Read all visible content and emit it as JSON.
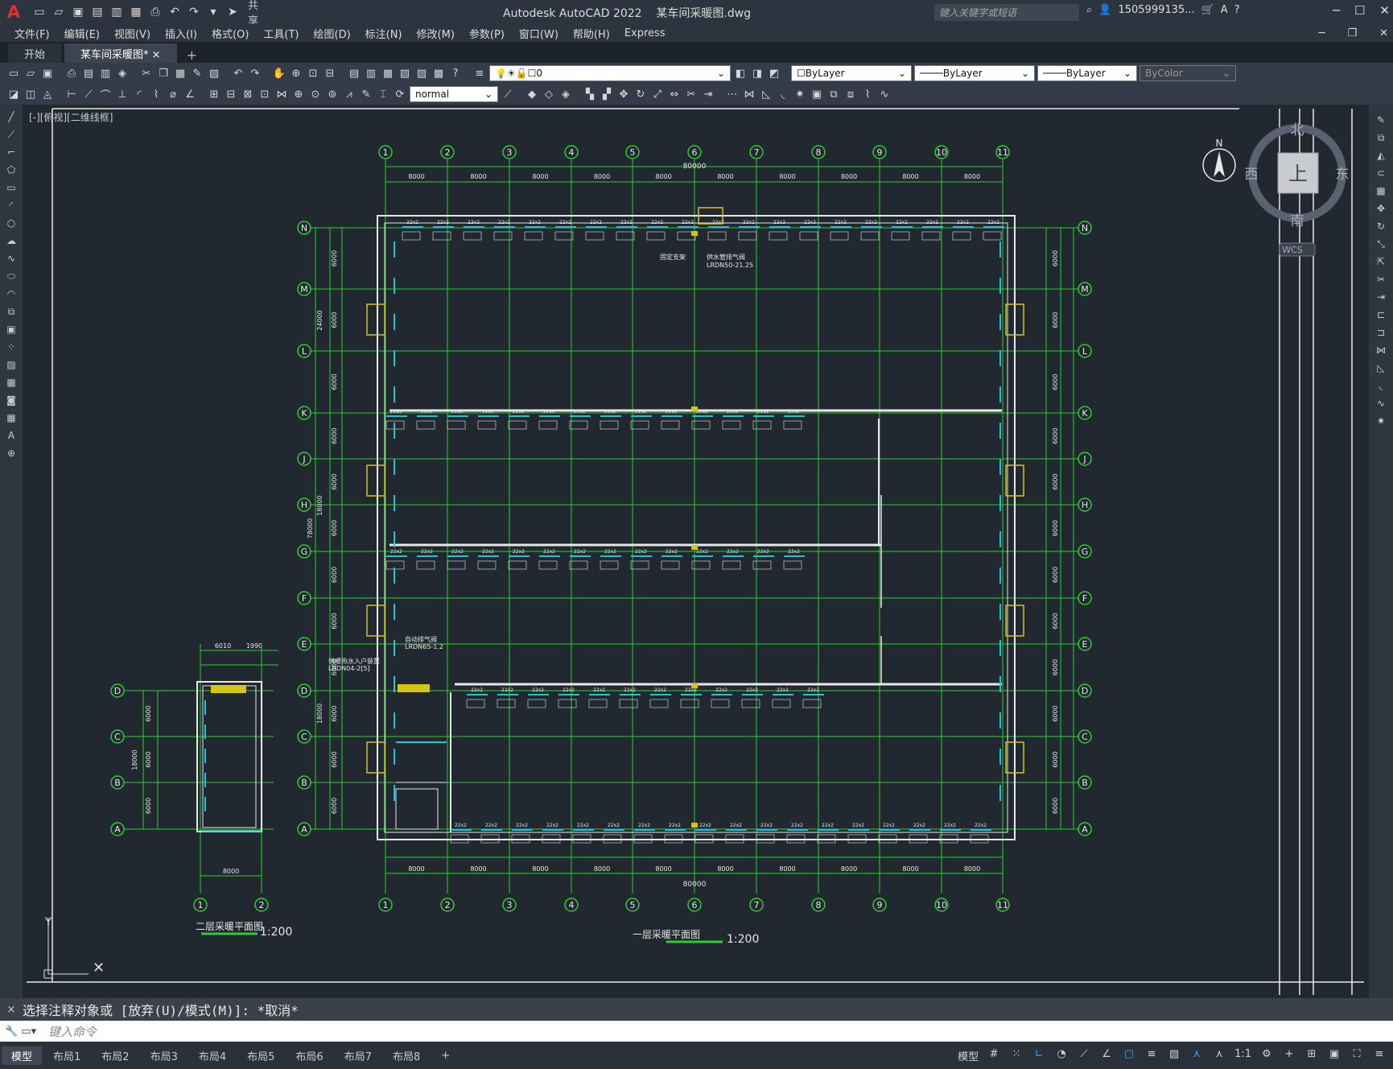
{
  "app": {
    "title": "Autodesk AutoCAD 2022",
    "file": "某车间采暖图.dwg",
    "share": "共享",
    "search_placeholder": "键入关键字或短语",
    "user": "1505999135...",
    "logo": "A"
  },
  "menu": [
    "文件(F)",
    "编辑(E)",
    "视图(V)",
    "插入(I)",
    "格式(O)",
    "工具(T)",
    "绘图(D)",
    "标注(N)",
    "修改(M)",
    "参数(P)",
    "窗口(W)",
    "帮助(H)",
    "Express"
  ],
  "tabs": {
    "start": "开始",
    "doc": "某车间采暖图*",
    "close": "×",
    "plus": "+"
  },
  "toolbar": {
    "layer": "0",
    "color": "ByLayer",
    "linetype": "ByLayer",
    "lineweight": "ByLayer",
    "plotstyle": "ByColor",
    "textstyle": "normal"
  },
  "viewport": {
    "label": "[-][俯视][二维线框]"
  },
  "viewcube": {
    "north": "北",
    "south": "南",
    "east": "东",
    "west": "西",
    "top": "上",
    "wcs": "WCS",
    "compass": "N"
  },
  "drawing": {
    "grid_cols": [
      "1",
      "2",
      "3",
      "4",
      "5",
      "6",
      "7",
      "8",
      "9",
      "10",
      "11"
    ],
    "grid_rows": [
      "N",
      "M",
      "L",
      "K",
      "J",
      "H",
      "G",
      "F",
      "E",
      "D",
      "C",
      "B",
      "A"
    ],
    "span": "8000",
    "total_width": "80000",
    "left_dims": [
      "6000",
      "6000",
      "6000",
      "6000",
      "6000",
      "6000",
      "6000",
      "6000",
      "6000",
      "6000",
      "6000",
      "6000"
    ],
    "left_totals": [
      "24000",
      "18000",
      "78000",
      "18000",
      "18000"
    ],
    "title1": "一层采暖平面图",
    "scale1": "1:200",
    "title2": "二层采暖平面图",
    "scale2": "1:200",
    "small_cols": [
      "1",
      "2"
    ],
    "small_rows": [
      "D",
      "C",
      "B",
      "A"
    ],
    "small_dims": [
      "6010",
      "1990"
    ],
    "small_bottom": "8000",
    "small_left": [
      "6000",
      "6000",
      "6000"
    ],
    "small_total": "18000",
    "ann1": "固定支架",
    "ann2": "供水管排气阀",
    "ann3": "LRDN50-21.25",
    "ann4": "自动排气阀",
    "ann5": "LRDN65-1.2",
    "ann6": "供暖热水入户装置",
    "ann7": "LRDN04-2[5]"
  },
  "command": {
    "history": "选择注释对象或 [放弃(U)/模式(M)]: *取消*",
    "placeholder": "键入命令",
    "close": "×"
  },
  "layouts": [
    "模型",
    "布局1",
    "布局2",
    "布局3",
    "布局4",
    "布局5",
    "布局6",
    "布局7",
    "布局8"
  ],
  "status": {
    "model": "模型",
    "scale": "1:1"
  }
}
